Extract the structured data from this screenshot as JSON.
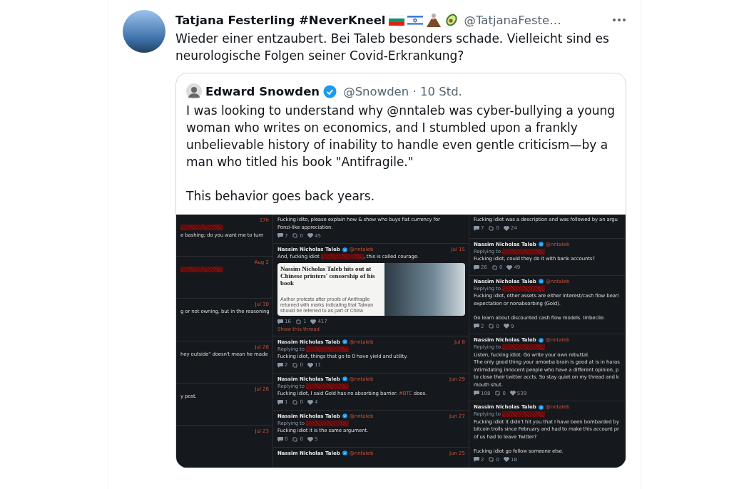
{
  "tweet": {
    "author": {
      "name": "Tatjana Festerling #NeverKneel",
      "badges": [
        {
          "kind": "bulgaria"
        },
        {
          "kind": "israel"
        },
        {
          "kind": "volcano"
        },
        {
          "kind": "avocado"
        }
      ],
      "handle": "@TatjanaFeste…"
    },
    "text": [
      "Wieder einer entzaubert. Bei Taleb besonders schade. Vielleicht sind es",
      "neurologische Folgen seiner Covid-Erkrankung?"
    ],
    "quote": {
      "name": "Edward Snowden",
      "verified": true,
      "handle": "@Snowden · 10 Std.",
      "paragraphs": [
        "I was looking to understand why @nntaleb was cyber-bullying a young woman who writes on economics, and I stumbled upon a frankly unbelievable history of inability to handle even gentle criticism—by a man who titled his book \"Antifragile.\"",
        "This behavior goes back years."
      ],
      "collage": {
        "columns": [
          {
            "posts": [
              {
                "date": "17h",
                "lines": [
                  {
                    "segs": [
                      {
                        "kind": "redacted"
                      }
                    ]
                  },
                  {
                    "segs": [
                      {
                        "kind": "text",
                        "value": "e bashing; do you want me to turn"
                      }
                    ]
                  }
                ]
              },
              {
                "date": "Aug 2",
                "lines": [
                  {
                    "segs": [
                      {
                        "kind": "redacted"
                      }
                    ]
                  }
                ]
              },
              {
                "date": "Jul 30",
                "lines": [
                  {
                    "segs": [
                      {
                        "kind": "text",
                        "value": "g or not owning, but in the reasoning"
                      }
                    ]
                  }
                ]
              },
              {
                "date": "Jul 28",
                "lines": [
                  {
                    "segs": [
                      {
                        "kind": "text",
                        "value": "hey outside\" doesn't mean he made"
                      }
                    ]
                  }
                ]
              },
              {
                "date": "Jul 26",
                "lines": [
                  {
                    "segs": [
                      {
                        "kind": "text",
                        "value": "y post."
                      }
                    ]
                  }
                ]
              },
              {
                "date": "Jul 23"
              }
            ]
          },
          {
            "posts": [
              {
                "lines": [
                  {
                    "segs": [
                      {
                        "kind": "text",
                        "value": "Fucking idito, please explain how & show who buys fiat currency for"
                      }
                    ]
                  },
                  {
                    "segs": [
                      {
                        "kind": "text",
                        "value": "Ponzi-like appreciation."
                      }
                    ]
                  }
                ],
                "stats": [
                  "7",
                  "0",
                  "45"
                ]
              },
              {
                "name": "Nassim Nicholas Taleb",
                "handle": "@nntaleb",
                "date": "Jul 15",
                "lines": [
                  {
                    "segs": [
                      {
                        "kind": "text",
                        "value": "And, fucking idiot "
                      },
                      {
                        "kind": "redacted"
                      },
                      {
                        "kind": "text",
                        "value": ", this is called courage."
                      }
                    ]
                  }
                ],
                "article": {
                  "headline": "Nassim Nicholas Taleb hits out at Chinese printers' censorship of his book",
                  "caption": "Author protests after proofs of Antifragile returned with marks indicating that Taiwan should be referred to as part of China"
                },
                "stats": [
                  "16",
                  "1",
                  "417"
                ],
                "link": "Show this thread"
              },
              {
                "name": "Nassim Nicholas Taleb",
                "handle": "@nntaleb",
                "date": "Jul 8",
                "replying": "Replying to",
                "lines": [
                  {
                    "segs": [
                      {
                        "kind": "text",
                        "value": "Fucking idiot, things that go to 0 have yield and utility."
                      }
                    ]
                  }
                ],
                "stats": [
                  "2",
                  "0",
                  "11"
                ]
              },
              {
                "name": "Nassim Nicholas Taleb",
                "handle": "@nntaleb",
                "date": "Jun 29",
                "replying": "Replying to",
                "lines": [
                  {
                    "segs": [
                      {
                        "kind": "text",
                        "value": "Fucking idiot, I said Gold has no absorbing barrier. "
                      },
                      {
                        "kind": "hashtag",
                        "value": "#BTC"
                      },
                      {
                        "kind": "text",
                        "value": " does."
                      }
                    ]
                  }
                ],
                "stats": [
                  "1",
                  "0",
                  "4"
                ]
              },
              {
                "name": "Nassim Nicholas Taleb",
                "handle": "@nntaleb",
                "date": "Jun 27",
                "replying": "Replying to",
                "lines": [
                  {
                    "segs": [
                      {
                        "kind": "text",
                        "value": "Fucking idiot it is the same argument."
                      }
                    ]
                  }
                ],
                "stats": [
                  "0",
                  "0",
                  "5"
                ]
              },
              {
                "name": "Nassim Nicholas Taleb",
                "handle": "@nntaleb",
                "date": "Jun 25"
              }
            ]
          },
          {
            "posts": [
              {
                "lines": [
                  {
                    "segs": [
                      {
                        "kind": "text",
                        "value": "Fucking idiot was a description and was followed by an argu"
                      }
                    ]
                  }
                ],
                "stats": [
                  "7",
                  "0",
                  "24"
                ]
              },
              {
                "name": "Nassim Nicholas Taleb",
                "handle": "@nntaleb",
                "replying": "Replying to",
                "lines": [
                  {
                    "segs": [
                      {
                        "kind": "text",
                        "value": "Fucking idiot,  could they do it with bank accounts?"
                      }
                    ]
                  }
                ],
                "stats": [
                  "26",
                  "0",
                  "49"
                ]
              },
              {
                "name": "Nassim Nicholas Taleb",
                "handle": "@nntaleb",
                "replying": "Replying to",
                "lines": [
                  {
                    "segs": [
                      {
                        "kind": "text",
                        "value": "Fucking idiot, other assets are either interest/cash flow beari"
                      }
                    ]
                  },
                  {
                    "segs": [
                      {
                        "kind": "text",
                        "value": "expectation or nonabsorbing (Gold)."
                      }
                    ]
                  },
                  {
                    "gap_before": true,
                    "segs": [
                      {
                        "kind": "text",
                        "value": "Go learn about discounted cash flow models. Imbecile."
                      }
                    ]
                  }
                ],
                "stats": [
                  "2",
                  "0",
                  "9"
                ]
              },
              {
                "name": "Nassim Nicholas Taleb",
                "handle": "@nntaleb",
                "replying": "Replying to",
                "lines": [
                  {
                    "segs": [
                      {
                        "kind": "text",
                        "value": "Listen, fucking idiot. Go write your own rebuttal."
                      }
                    ]
                  },
                  {
                    "segs": [
                      {
                        "kind": "text",
                        "value": "The only good thing your amoeba brain is good at is in haras"
                      }
                    ]
                  },
                  {
                    "segs": [
                      {
                        "kind": "text",
                        "value": "intimidating innocent people who have a different opinion, p"
                      }
                    ]
                  },
                  {
                    "segs": [
                      {
                        "kind": "text",
                        "value": "to close their twitter accts. So stay quiet on my thread and k"
                      }
                    ]
                  },
                  {
                    "segs": [
                      {
                        "kind": "text",
                        "value": "mouth shut."
                      }
                    ]
                  }
                ],
                "stats": [
                  "108",
                  "0",
                  "539"
                ]
              },
              {
                "name": "Nassim Nicholas Taleb",
                "handle": "@nntaleb",
                "replying": "Replying to",
                "lines": [
                  {
                    "segs": [
                      {
                        "kind": "text",
                        "value": "Fucking idiot it didn't hit you that I have been bombarded by"
                      }
                    ]
                  },
                  {
                    "segs": [
                      {
                        "kind": "text",
                        "value": "bitcoin trolls since February and had to make this account pr"
                      }
                    ]
                  },
                  {
                    "segs": [
                      {
                        "kind": "text",
                        "value": "of us had to leave Twitter?"
                      }
                    ]
                  },
                  {
                    "gap_before": true,
                    "segs": [
                      {
                        "kind": "text",
                        "value": "Fucking idiot go follow someone else."
                      }
                    ]
                  }
                ],
                "stats": [
                  "2",
                  "0",
                  "18"
                ]
              }
            ]
          }
        ]
      }
    }
  }
}
